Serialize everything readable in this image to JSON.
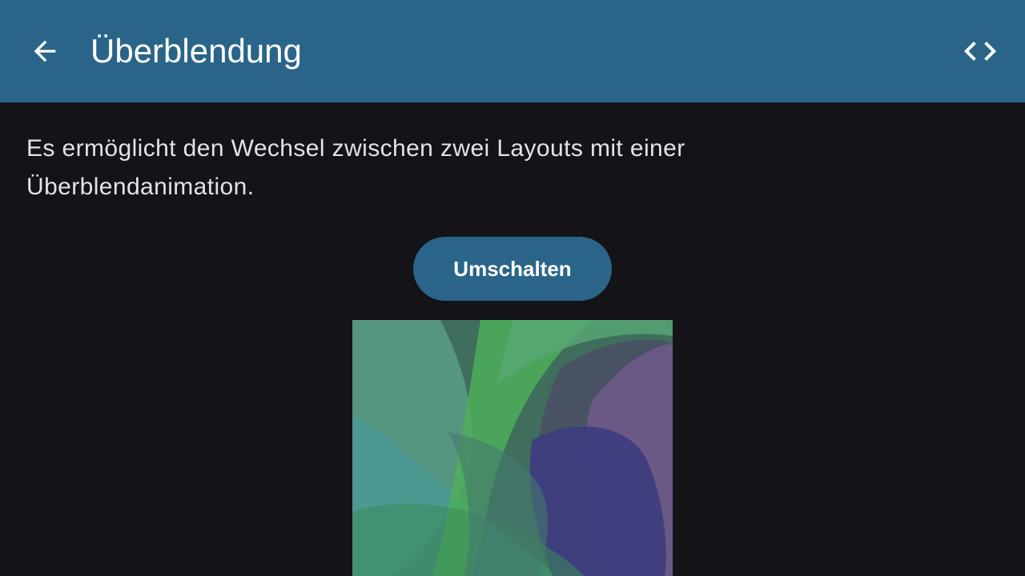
{
  "appbar": {
    "title": "Überblendung",
    "back_icon": "arrow-back-icon",
    "code_icon": "code-icon",
    "background_color": "#2a6589"
  },
  "content": {
    "description": "Es ermöglicht den Wechsel zwischen zwei Layouts mit einer Überblendanimation.",
    "toggle_button_label": "Umschalten",
    "image_name": "abstract-wallpaper-image"
  },
  "colors": {
    "page_background": "#141318",
    "accent": "#2a6589",
    "text": "#e6e1e9"
  }
}
